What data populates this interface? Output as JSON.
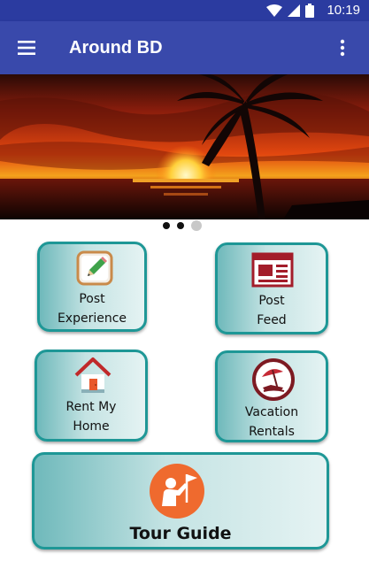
{
  "status_bar": {
    "time": "10:19"
  },
  "app_bar": {
    "title": "Around BD"
  },
  "carousel": {
    "total_slides": 3,
    "active_slide": 2
  },
  "tiles": [
    {
      "line1": "Post",
      "line2": "Experience",
      "icon": "pencil-icon"
    },
    {
      "line1": "Post",
      "line2": "Feed",
      "icon": "newspaper-icon"
    },
    {
      "line1": "Rent My",
      "line2": "Home",
      "icon": "house-icon"
    },
    {
      "line1": "Vacation",
      "line2": "Rentals",
      "icon": "beach-umbrella-icon"
    },
    {
      "line1": "Tour Guide",
      "icon": "tour-guide-flag-icon"
    }
  ],
  "colors": {
    "status_bar": "#2b3ba0",
    "app_bar": "#3949ab",
    "tile_border": "#1e9796"
  }
}
